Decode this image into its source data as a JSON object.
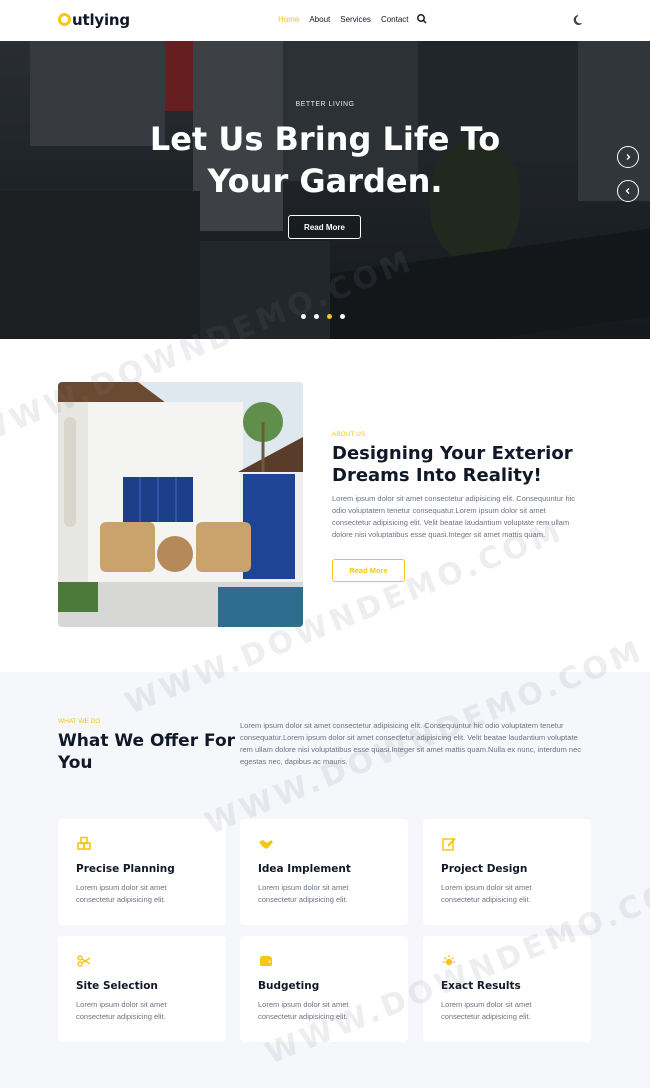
{
  "brand": {
    "logo_rest": "utlying",
    "accent": "#f5c518"
  },
  "nav": {
    "items": [
      {
        "label": "Home",
        "active": true
      },
      {
        "label": "About",
        "active": false
      },
      {
        "label": "Services",
        "active": false
      },
      {
        "label": "Contact",
        "active": false
      }
    ],
    "icons": [
      "search-icon",
      "moon-icon"
    ]
  },
  "hero": {
    "eyebrow": "BETTER LIVING",
    "title_line1": "Let Us Bring Life To",
    "title_line2": "Your Garden.",
    "button": "Read More",
    "slides": 4,
    "active_slide": 3
  },
  "about": {
    "eyebrow": "ABOUT US",
    "title": "Designing Your Exterior Dreams Into Reality!",
    "text": "Lorem ipsum dolor sit amet consectetur adipisicing elit. Consequuntur hic odio voluptatem tenetur consequatur.Lorem ipsum dolor sit amet consectetur adipisicing elit. Velit beatae laudantium voluptate rem ullam dolore nisi voluptatibus esse quasi.Integer sit amet mattis quam.",
    "button": "Read More"
  },
  "offer": {
    "eyebrow": "WHAT WE DO",
    "title": "What We Offer For You",
    "text": "Lorem ipsum dolor sit amet consectetur adipisicing elit. Consequuntur hic odio voluptatem tenetur consequatur.Lorem ipsum dolor sit amet consectetur adipisicing elit. Velit beatae laudantium voluptate rem ullam dolore nisi voluptatibus esse quasi.Integer sit amet mattis quam.Nulla ex nunc, interdum nec egestas nec, dapibus ac mauris.",
    "cards": [
      {
        "title": "Precise Planning",
        "text": "Lorem ipsum dolor sit amet consectetur adipisicing elit.",
        "icon": "cubes-icon"
      },
      {
        "title": "Idea Implement",
        "text": "Lorem ipsum dolor sit amet consectetur adipisicing elit.",
        "icon": "handshake-icon"
      },
      {
        "title": "Project Design",
        "text": "Lorem ipsum dolor sit amet consectetur adipisicing elit.",
        "icon": "edit-icon"
      },
      {
        "title": "Site Selection",
        "text": "Lorem ipsum dolor sit amet consectetur adipisicing elit.",
        "icon": "scissors-icon"
      },
      {
        "title": "Budgeting",
        "text": "Lorem ipsum dolor sit amet consectetur adipisicing elit.",
        "icon": "wallet-icon"
      },
      {
        "title": "Exact Results",
        "text": "Lorem ipsum dolor sit amet consectetur adipisicing elit.",
        "icon": "sun-icon"
      }
    ]
  },
  "watermark": {
    "text": "WWW.DOWNDEMO.COM"
  }
}
